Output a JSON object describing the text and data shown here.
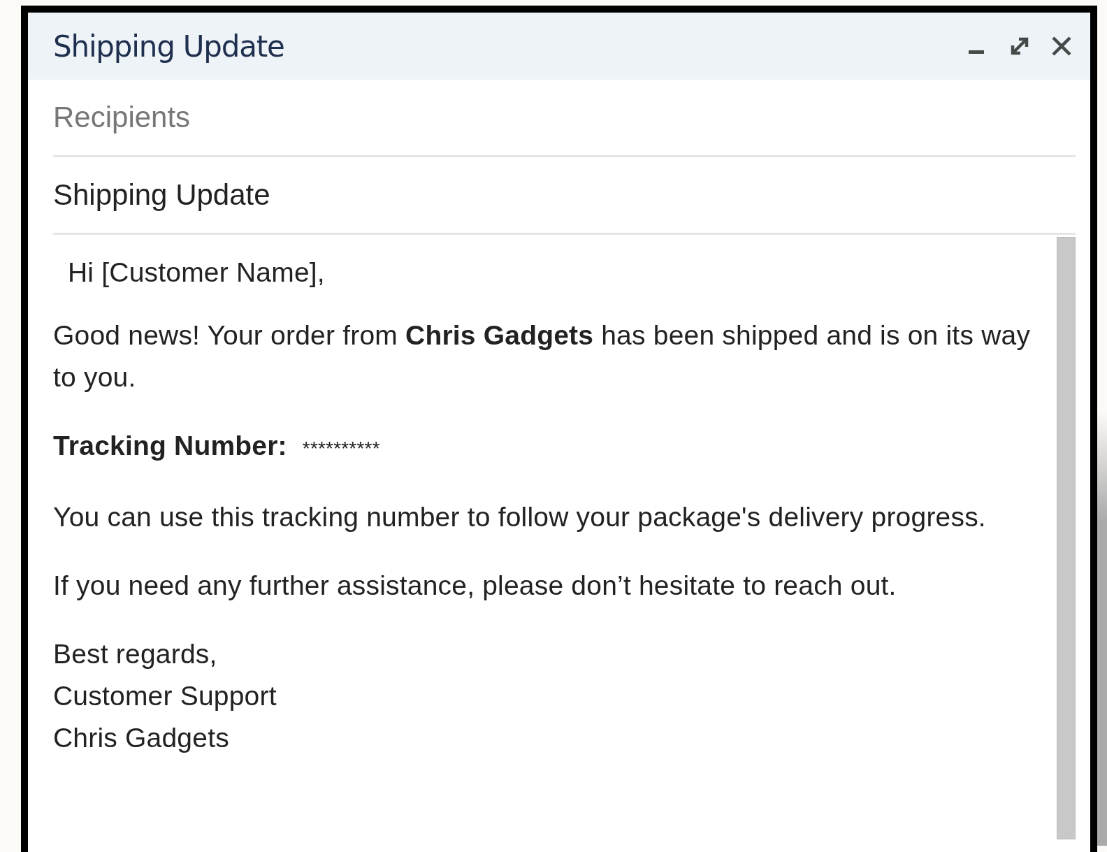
{
  "window": {
    "title": "Shipping Update"
  },
  "recipients": {
    "placeholder": "Recipients"
  },
  "subject": {
    "value": "Shipping Update"
  },
  "body": [
    {
      "kind": "greeting",
      "text": "Hi [Customer Name],"
    },
    {
      "kind": "paragraph",
      "text": "Good news! Your order from **Chris Gadgets** has been shipped and is on its way to you."
    },
    {
      "kind": "field",
      "label": "Tracking Number:",
      "value": "**********"
    },
    {
      "kind": "paragraph",
      "text": "You can use this tracking number to follow your package's delivery progress."
    },
    {
      "kind": "paragraph",
      "text": "If you need any further assistance, please don’t hesitate to reach out."
    },
    {
      "kind": "signature",
      "lines": [
        "Best regards,",
        "Customer Support",
        "Chris Gadgets"
      ]
    }
  ]
}
